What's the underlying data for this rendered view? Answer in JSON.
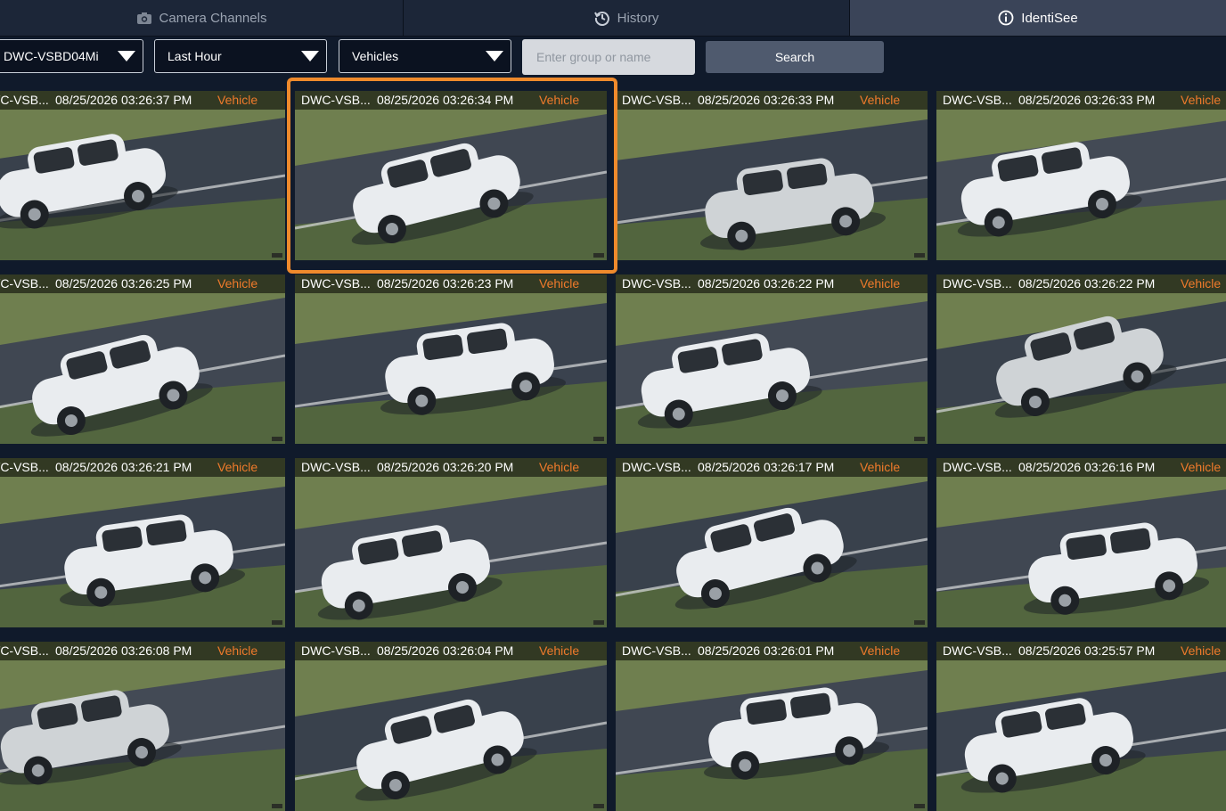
{
  "tabs": [
    {
      "label": "Camera Channels",
      "icon": "camera-icon"
    },
    {
      "label": "History",
      "icon": "history-icon"
    },
    {
      "label": "IdentiSee",
      "icon": "info-icon",
      "active": true
    }
  ],
  "toolbar": {
    "camera_value": "DWC-VSBD04Mi",
    "time_value": "Last Hour",
    "type_value": "Vehicles",
    "search_placeholder": "Enter group or name",
    "search_label": "Search"
  },
  "colors": {
    "accent": "#ef8a2c",
    "tag": "#ef7a2b",
    "bg": "#101a2b",
    "active_tab": "#3a4458"
  },
  "cards": [
    {
      "camera": "DWC-VSB...",
      "time": "08/25/2026 03:26:37 PM",
      "type": "Vehicle"
    },
    {
      "camera": "DWC-VSB...",
      "time": "08/25/2026 03:26:34 PM",
      "type": "Vehicle",
      "selected": true
    },
    {
      "camera": "DWC-VSB...",
      "time": "08/25/2026 03:26:33 PM",
      "type": "Vehicle"
    },
    {
      "camera": "DWC-VSB...",
      "time": "08/25/2026 03:26:33 PM",
      "type": "Vehicle"
    },
    {
      "camera": "DWC-VSB...",
      "time": "08/25/2026 03:26:25 PM",
      "type": "Vehicle"
    },
    {
      "camera": "DWC-VSB...",
      "time": "08/25/2026 03:26:23 PM",
      "type": "Vehicle"
    },
    {
      "camera": "DWC-VSB...",
      "time": "08/25/2026 03:26:22 PM",
      "type": "Vehicle"
    },
    {
      "camera": "DWC-VSB...",
      "time": "08/25/2026 03:26:22 PM",
      "type": "Vehicle"
    },
    {
      "camera": "DWC-VSB...",
      "time": "08/25/2026 03:26:21 PM",
      "type": "Vehicle"
    },
    {
      "camera": "DWC-VSB...",
      "time": "08/25/2026 03:26:20 PM",
      "type": "Vehicle"
    },
    {
      "camera": "DWC-VSB...",
      "time": "08/25/2026 03:26:17 PM",
      "type": "Vehicle"
    },
    {
      "camera": "DWC-VSB...",
      "time": "08/25/2026 03:26:16 PM",
      "type": "Vehicle"
    },
    {
      "camera": "DWC-VSB...",
      "time": "08/25/2026 03:26:08 PM",
      "type": "Vehicle"
    },
    {
      "camera": "DWC-VSB...",
      "time": "08/25/2026 03:26:04 PM",
      "type": "Vehicle"
    },
    {
      "camera": "DWC-VSB...",
      "time": "08/25/2026 03:26:01 PM",
      "type": "Vehicle"
    },
    {
      "camera": "DWC-VSB...",
      "time": "08/25/2026 03:25:57 PM",
      "type": "Vehicle"
    }
  ]
}
